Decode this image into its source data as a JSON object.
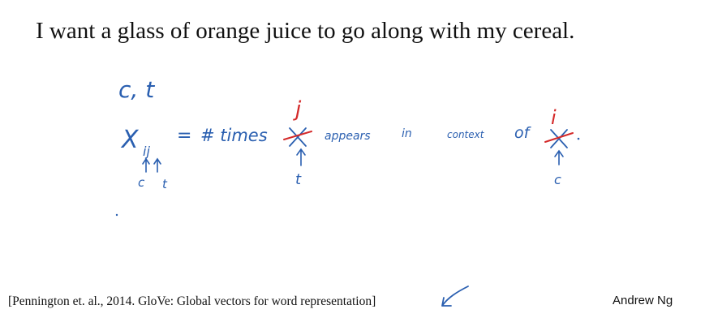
{
  "slide": {
    "headline": "I want a glass of orange juice to go along with my cereal.",
    "citation": "[Pennington et. al., 2014. GloVe: Global vectors for word representation]",
    "author": "Andrew Ng"
  },
  "handwriting": {
    "pair": "c, t",
    "symbol": "X",
    "subscript": "ij",
    "equals": "=",
    "times": "# times",
    "index_j": "j",
    "appears": "appears",
    "in": "in",
    "context": "context",
    "of": "of",
    "index_i": "i",
    "label_c": "c",
    "label_t": "t",
    "colors": {
      "blue": "#2a5fb0",
      "red": "#d42a2a"
    }
  }
}
